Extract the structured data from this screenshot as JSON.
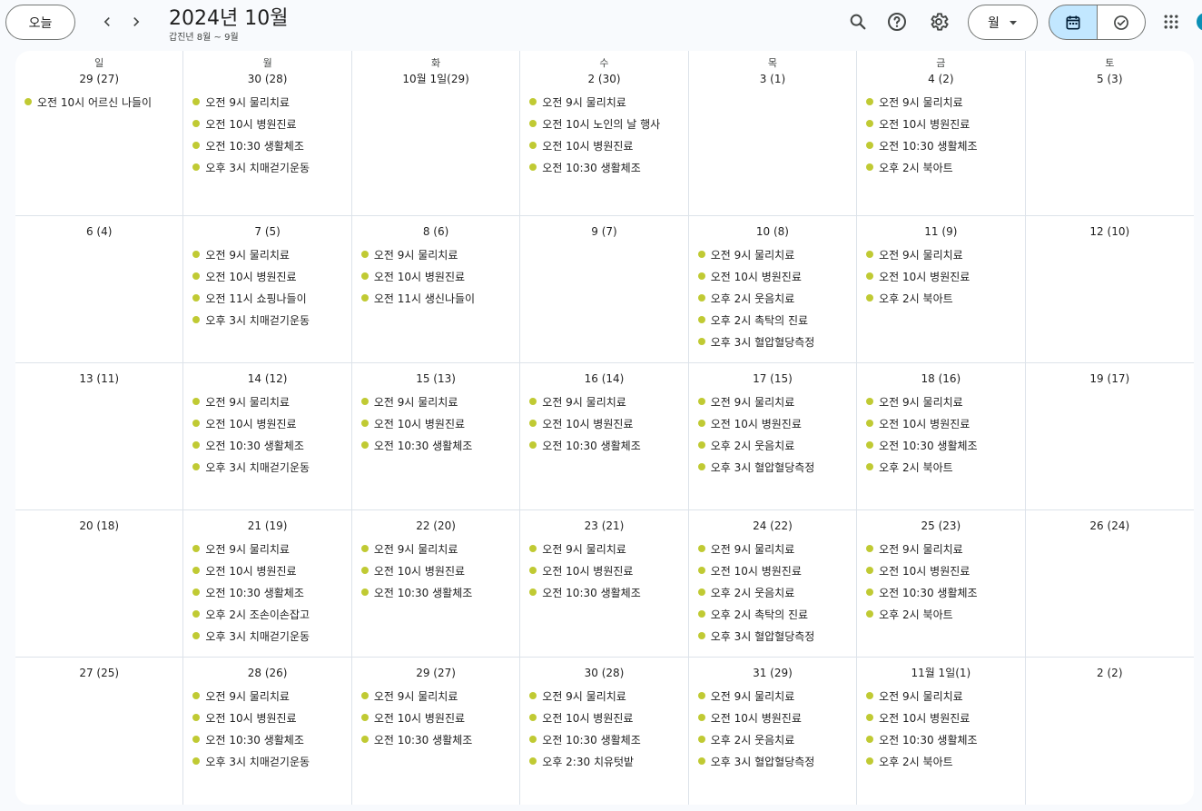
{
  "toolbar": {
    "today_label": "오늘",
    "title": "2024년 10월",
    "subtitle": "갑진년 8월 ~ 9월",
    "view_label": "월",
    "prev_icon": "chevron-left-icon",
    "next_icon": "chevron-right-icon",
    "search_icon": "search-icon",
    "help_icon": "help-icon",
    "settings_icon": "gear-icon",
    "calendar_icon": "calendar-icon",
    "tasks_icon": "check-circle-icon",
    "apps_icon": "apps-grid-icon"
  },
  "colors": {
    "event_dot": "#c0ca33",
    "selected_segment": "#c2e7ff",
    "grid_line": "#dde3ea"
  },
  "weekdays": [
    "일",
    "월",
    "화",
    "수",
    "목",
    "금",
    "토"
  ],
  "weeks": [
    [
      {
        "date": "29 (27)",
        "events": [
          "오전 10시 어르신 나들이"
        ]
      },
      {
        "date": "30 (28)",
        "events": [
          "오전 9시 물리치료",
          "오전 10시 병원진료",
          "오전 10:30 생활체조",
          "오후 3시 치매걷기운동"
        ]
      },
      {
        "date": "10월 1일(29)",
        "events": []
      },
      {
        "date": "2 (30)",
        "events": [
          "오전 9시 물리치료",
          "오전 10시 노인의 날 행사",
          "오전 10시 병원진료",
          "오전 10:30 생활체조"
        ]
      },
      {
        "date": "3 (1)",
        "events": []
      },
      {
        "date": "4 (2)",
        "events": [
          "오전 9시 물리치료",
          "오전 10시 병원진료",
          "오전 10:30 생활체조",
          "오후 2시 북아트"
        ]
      },
      {
        "date": "5 (3)",
        "events": []
      }
    ],
    [
      {
        "date": "6 (4)",
        "events": []
      },
      {
        "date": "7 (5)",
        "events": [
          "오전 9시 물리치료",
          "오전 10시 병원진료",
          "오전 11시 쇼핑나들이",
          "오후 3시 치매걷기운동"
        ]
      },
      {
        "date": "8 (6)",
        "events": [
          "오전 9시 물리치료",
          "오전 10시 병원진료",
          "오전 11시 생신나들이"
        ]
      },
      {
        "date": "9 (7)",
        "events": []
      },
      {
        "date": "10 (8)",
        "events": [
          "오전 9시 물리치료",
          "오전 10시 병원진료",
          "오후 2시 웃음치료",
          "오후 2시 촉탁의 진료",
          "오후 3시 혈압혈당측정"
        ]
      },
      {
        "date": "11 (9)",
        "events": [
          "오전 9시 물리치료",
          "오전 10시 병원진료",
          "오후 2시 북아트"
        ]
      },
      {
        "date": "12 (10)",
        "events": []
      }
    ],
    [
      {
        "date": "13 (11)",
        "events": []
      },
      {
        "date": "14 (12)",
        "events": [
          "오전 9시 물리치료",
          "오전 10시 병원진료",
          "오전 10:30 생활체조",
          "오후 3시 치매걷기운동"
        ]
      },
      {
        "date": "15 (13)",
        "events": [
          "오전 9시 물리치료",
          "오전 10시 병원진료",
          "오전 10:30 생활체조"
        ]
      },
      {
        "date": "16 (14)",
        "events": [
          "오전 9시 물리치료",
          "오전 10시 병원진료",
          "오전 10:30 생활체조"
        ]
      },
      {
        "date": "17 (15)",
        "events": [
          "오전 9시 물리치료",
          "오전 10시 병원진료",
          "오후 2시 웃음치료",
          "오후 3시 혈압혈당측정"
        ]
      },
      {
        "date": "18 (16)",
        "events": [
          "오전 9시 물리치료",
          "오전 10시 병원진료",
          "오전 10:30 생활체조",
          "오후 2시 북아트"
        ]
      },
      {
        "date": "19 (17)",
        "events": []
      }
    ],
    [
      {
        "date": "20 (18)",
        "events": []
      },
      {
        "date": "21 (19)",
        "events": [
          "오전 9시 물리치료",
          "오전 10시 병원진료",
          "오전 10:30 생활체조",
          "오후 2시 조손이손잡고",
          "오후 3시 치매걷기운동"
        ]
      },
      {
        "date": "22 (20)",
        "events": [
          "오전 9시 물리치료",
          "오전 10시 병원진료",
          "오전 10:30 생활체조"
        ]
      },
      {
        "date": "23 (21)",
        "events": [
          "오전 9시 물리치료",
          "오전 10시 병원진료",
          "오전 10:30 생활체조"
        ]
      },
      {
        "date": "24 (22)",
        "events": [
          "오전 9시 물리치료",
          "오전 10시 병원진료",
          "오후 2시 웃음치료",
          "오후 2시 촉탁의 진료",
          "오후 3시 혈압혈당측정"
        ]
      },
      {
        "date": "25 (23)",
        "events": [
          "오전 9시 물리치료",
          "오전 10시 병원진료",
          "오전 10:30 생활체조",
          "오후 2시 북아트"
        ]
      },
      {
        "date": "26 (24)",
        "events": []
      }
    ],
    [
      {
        "date": "27 (25)",
        "events": []
      },
      {
        "date": "28 (26)",
        "events": [
          "오전 9시 물리치료",
          "오전 10시 병원진료",
          "오전 10:30 생활체조",
          "오후 3시 치매걷기운동"
        ]
      },
      {
        "date": "29 (27)",
        "events": [
          "오전 9시 물리치료",
          "오전 10시 병원진료",
          "오전 10:30 생활체조"
        ]
      },
      {
        "date": "30 (28)",
        "events": [
          "오전 9시 물리치료",
          "오전 10시 병원진료",
          "오전 10:30 생활체조",
          "오후 2:30 치유텃밭"
        ]
      },
      {
        "date": "31 (29)",
        "events": [
          "오전 9시 물리치료",
          "오전 10시 병원진료",
          "오후 2시 웃음치료",
          "오후 3시 혈압혈당측정"
        ]
      },
      {
        "date": "11월 1일(1)",
        "events": [
          "오전 9시 물리치료",
          "오전 10시 병원진료",
          "오전 10:30 생활체조",
          "오후 2시 북아트"
        ]
      },
      {
        "date": "2 (2)",
        "events": []
      }
    ]
  ]
}
